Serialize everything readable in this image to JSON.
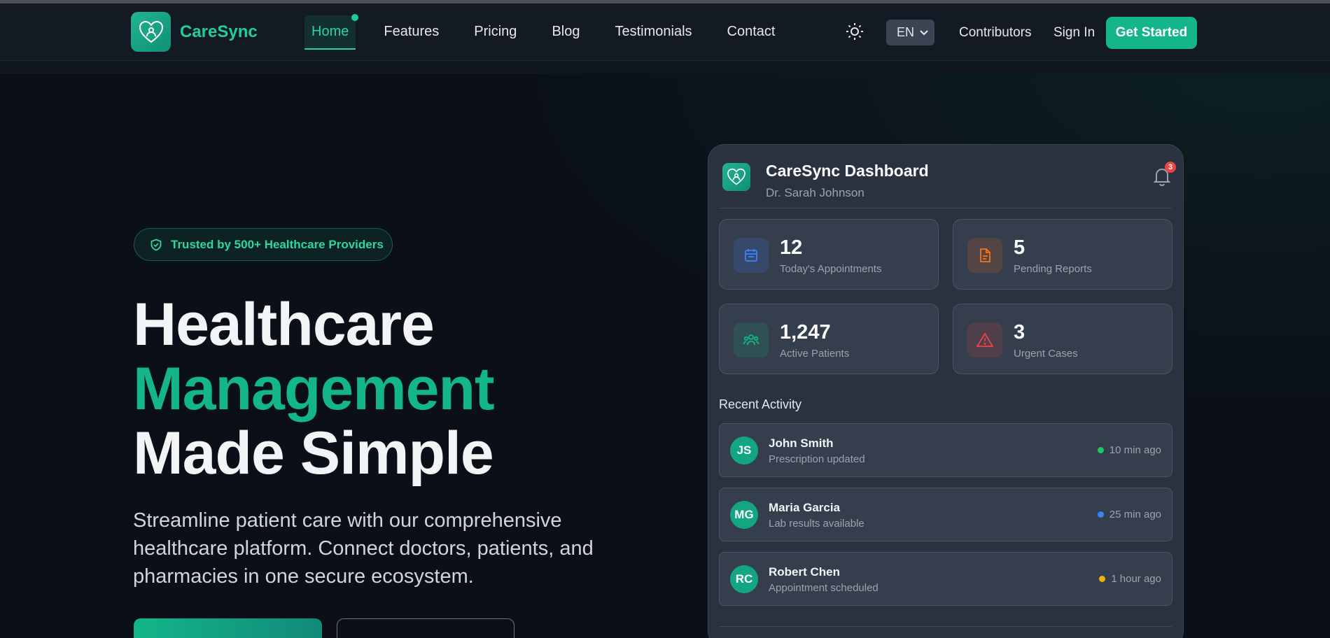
{
  "brand": {
    "name": "CareSync"
  },
  "nav": {
    "links": [
      {
        "label": "Home",
        "active": true
      },
      {
        "label": "Features"
      },
      {
        "label": "Pricing"
      },
      {
        "label": "Blog"
      },
      {
        "label": "Testimonials"
      },
      {
        "label": "Contact"
      }
    ],
    "theme_icon": "sun-icon",
    "language": "EN",
    "contributors": "Contributors",
    "sign_in": "Sign In",
    "get_started": "Get Started"
  },
  "hero": {
    "badge": "Trusted by 500+ Healthcare Providers",
    "title_line1": "Healthcare",
    "title_line2": "Management",
    "title_line3": "Made Simple",
    "subtitle": "Streamline patient care with our comprehensive healthcare platform. Connect doctors, patients, and pharmacies in one secure ecosystem."
  },
  "dashboard": {
    "title": "CareSync Dashboard",
    "user": "Dr. Sarah Johnson",
    "notification_count": "3",
    "stats": [
      {
        "value": "12",
        "label": "Today's Appointments",
        "icon": "calendar-icon",
        "color": "#3b82f6"
      },
      {
        "value": "5",
        "label": "Pending Reports",
        "icon": "document-icon",
        "color": "#f97316"
      },
      {
        "value": "1,247",
        "label": "Active Patients",
        "icon": "users-icon",
        "color": "#10b981"
      },
      {
        "value": "3",
        "label": "Urgent Cases",
        "icon": "alert-icon",
        "color": "#ef4444"
      }
    ],
    "recent_title": "Recent Activity",
    "activity": [
      {
        "initials": "JS",
        "name": "John Smith",
        "desc": "Prescription updated",
        "time": "10 min ago",
        "dot": "#22c55e"
      },
      {
        "initials": "MG",
        "name": "Maria Garcia",
        "desc": "Lab results available",
        "time": "25 min ago",
        "dot": "#3b82f6"
      },
      {
        "initials": "RC",
        "name": "Robert Chen",
        "desc": "Appointment scheduled",
        "time": "1 hour ago",
        "dot": "#eab308"
      }
    ]
  },
  "colors": {
    "accent": "#14b58a",
    "background": "#0b0f17",
    "card": "#2a3240"
  }
}
